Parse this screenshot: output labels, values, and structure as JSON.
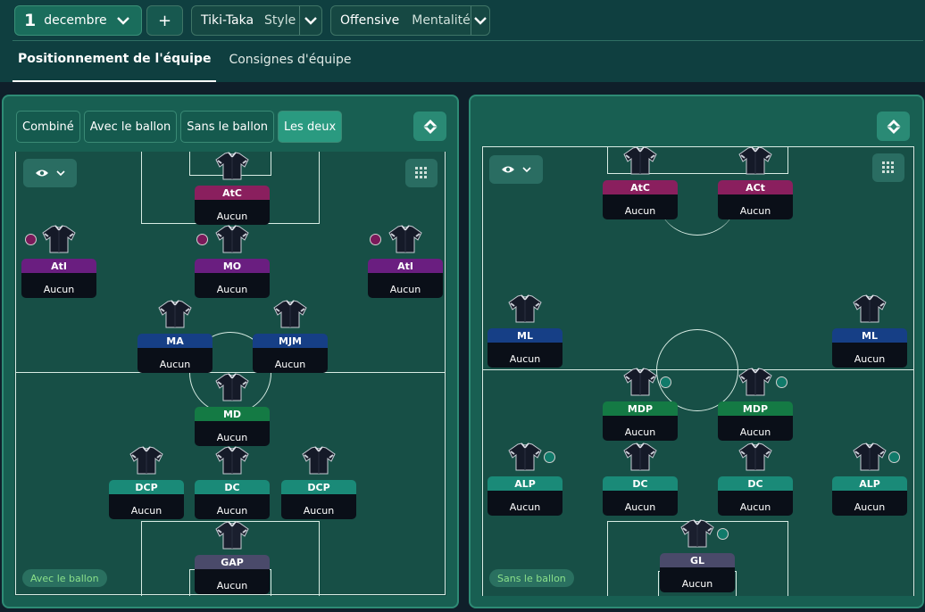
{
  "top": {
    "date_day": "1",
    "date_month": "decembre",
    "plus": "+",
    "style_value": "Tiki-Taka",
    "style_label": "Style",
    "mentality_value": "Offensive",
    "mentality_label": "Mentalité"
  },
  "tabs": [
    "Positionnement de l'équipe",
    "Consignes d'équipe"
  ],
  "left": {
    "segments": [
      "Combiné",
      "Avec le ballon",
      "Sans le ballon",
      "Les deux"
    ],
    "selected_segment": "Les deux",
    "pill": "Avec le ballon",
    "players": [
      {
        "role": "AtC",
        "duty": "Aucun",
        "color": "#8a1f5e",
        "ball": false
      },
      {
        "role": "AtI",
        "duty": "Aucun",
        "color": "#6a1e80",
        "ball": true
      },
      {
        "role": "MO",
        "duty": "Aucun",
        "color": "#6a1e80",
        "ball": true
      },
      {
        "role": "AtI",
        "duty": "Aucun",
        "color": "#6a1e80",
        "ball": true
      },
      {
        "role": "MA",
        "duty": "Aucun",
        "color": "#163f86",
        "ball": false
      },
      {
        "role": "MJM",
        "duty": "Aucun",
        "color": "#163f86",
        "ball": false
      },
      {
        "role": "MD",
        "duty": "Aucun",
        "color": "#147a44",
        "ball": false
      },
      {
        "role": "DCP",
        "duty": "Aucun",
        "color": "#1a8a78",
        "ball": false
      },
      {
        "role": "DC",
        "duty": "Aucun",
        "color": "#1a8a78",
        "ball": false
      },
      {
        "role": "DCP",
        "duty": "Aucun",
        "color": "#1a8a78",
        "ball": false
      },
      {
        "role": "GAP",
        "duty": "Aucun",
        "color": "#4a4a6a",
        "ball": false
      }
    ]
  },
  "right": {
    "pill": "Sans le ballon",
    "players": [
      {
        "role": "AtC",
        "duty": "Aucun",
        "color": "#8a1f5e",
        "ball": false
      },
      {
        "role": "ACt",
        "duty": "Aucun",
        "color": "#8a1f5e",
        "ball": false
      },
      {
        "role": "ML",
        "duty": "Aucun",
        "color": "#163f86",
        "ball": false
      },
      {
        "role": "ML",
        "duty": "Aucun",
        "color": "#163f86",
        "ball": false
      },
      {
        "role": "MDP",
        "duty": "Aucun",
        "color": "#147a44",
        "ball": true
      },
      {
        "role": "MDP",
        "duty": "Aucun",
        "color": "#147a44",
        "ball": true
      },
      {
        "role": "ALP",
        "duty": "Aucun",
        "color": "#1a8a78",
        "ball": true
      },
      {
        "role": "DC",
        "duty": "Aucun",
        "color": "#1a8a78",
        "ball": false
      },
      {
        "role": "DC",
        "duty": "Aucun",
        "color": "#1a8a78",
        "ball": false
      },
      {
        "role": "ALP",
        "duty": "Aucun",
        "color": "#1a8a78",
        "ball": true
      },
      {
        "role": "GL",
        "duty": "Aucun",
        "color": "#4a4a6a",
        "ball": true
      }
    ]
  },
  "colors": {
    "attack_ball": "#7a1a5a",
    "defend_ball": "#117a6a"
  }
}
